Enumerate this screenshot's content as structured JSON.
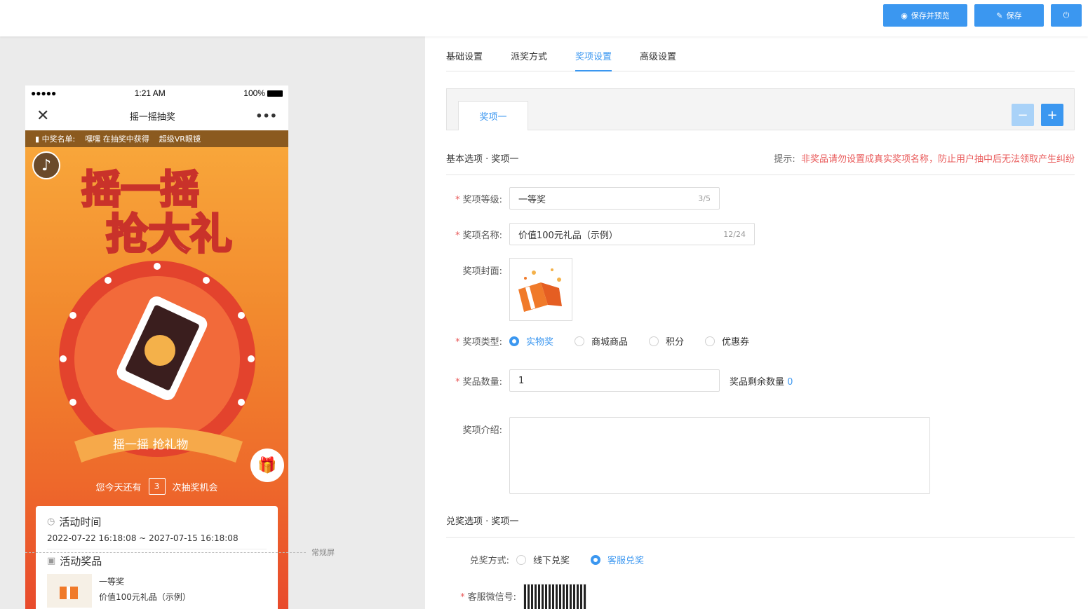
{
  "toolbar": {
    "save_preview_label": "保存并预览",
    "save_label": "保存",
    "colors": {
      "primary": "#3b97f0"
    }
  },
  "phone": {
    "status_time": "1:21 AM",
    "status_battery": "100%",
    "nav_title": "摇一摇抽奖",
    "winner_label": "中奖名单:",
    "winner_name": "嘿嘿",
    "winner_action": "在抽奖中获得",
    "winner_prize": "超级VR眼镜",
    "chance_prefix": "您今天还有",
    "chance_count": "3",
    "chance_suffix": "次抽奖机会",
    "activity_time_title": "活动时间",
    "activity_time_value": "2022-07-22 16:18:08 ~ 2027-07-15 16:18:08",
    "activity_prize_title": "活动奖品",
    "prize_level": "一等奖",
    "prize_name": "价值100元礼品（示例）"
  },
  "fold_label": "常规屏",
  "tabs": [
    {
      "label": "基础设置",
      "active": false
    },
    {
      "label": "派奖方式",
      "active": false
    },
    {
      "label": "奖项设置",
      "active": true
    },
    {
      "label": "高级设置",
      "active": false
    }
  ],
  "prize_tab_label": "奖项一",
  "basic_section": {
    "title": "基本选项 · 奖项一",
    "hint_label": "提示:",
    "hint_text": "非奖品请勿设置成真实奖项名称，防止用户抽中后无法领取产生纠纷"
  },
  "form": {
    "level_label": "奖项等级:",
    "level_value": "一等奖",
    "level_count": "3/5",
    "name_label": "奖项名称:",
    "name_value": "价值100元礼品（示例）",
    "name_count": "12/24",
    "cover_label": "奖项封面:",
    "type_label": "奖项类型:",
    "type_options": [
      "实物奖",
      "商城商品",
      "积分",
      "优惠券"
    ],
    "type_selected": "实物奖",
    "qty_label": "奖品数量:",
    "qty_value": "1",
    "remain_label": "奖品剩余数量",
    "remain_value": "0",
    "intro_label": "奖项介绍:"
  },
  "redeem_section": {
    "title": "兑奖选项 · 奖项一",
    "method_label": "兑奖方式:",
    "method_options": [
      "线下兑奖",
      "客服兑奖"
    ],
    "method_selected": "客服兑奖",
    "wechat_label": "客服微信号:"
  }
}
